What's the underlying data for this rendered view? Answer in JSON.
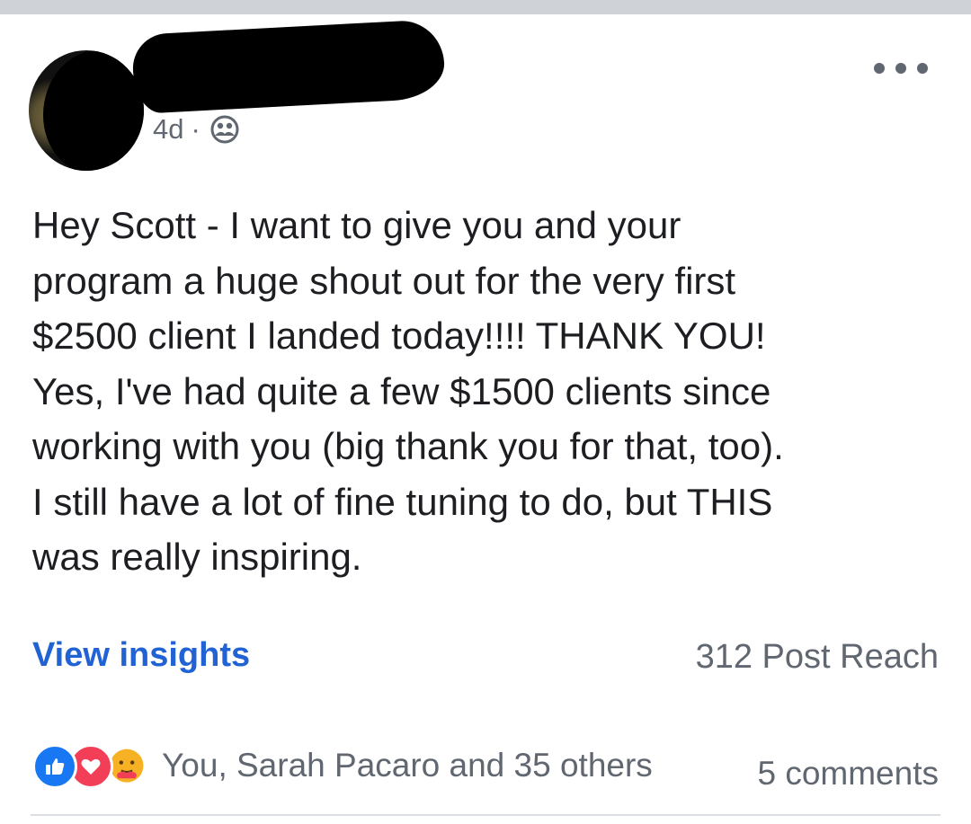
{
  "post": {
    "timestamp": "4d",
    "separator": "·",
    "privacy_icon": "friends-icon",
    "more_icon": "more-horizontal-icon",
    "body_lines": [
      "Hey Scott - I want to give you and your",
      "program a huge shout out for the very first",
      "$2500 client I landed today!!!! THANK YOU!",
      "Yes, I've had quite a few $1500 clients since",
      "working with you (big thank you for that, too).",
      "I still have a lot of fine tuning to do, but THIS",
      "was really inspiring."
    ]
  },
  "insights": {
    "link_label": "View insights",
    "reach_label": "312 Post Reach"
  },
  "engagement": {
    "reaction_icons": [
      "like-icon",
      "love-icon",
      "care-icon"
    ],
    "reactions_text": "You, Sarah Pacaro and 35 others",
    "comments_label": "5 comments"
  },
  "colors": {
    "link": "#2163d4",
    "muted_text": "#606770",
    "body_text": "#1c1e21",
    "like": "#1877f2",
    "love": "#f33e58",
    "care": "#f7b125"
  }
}
